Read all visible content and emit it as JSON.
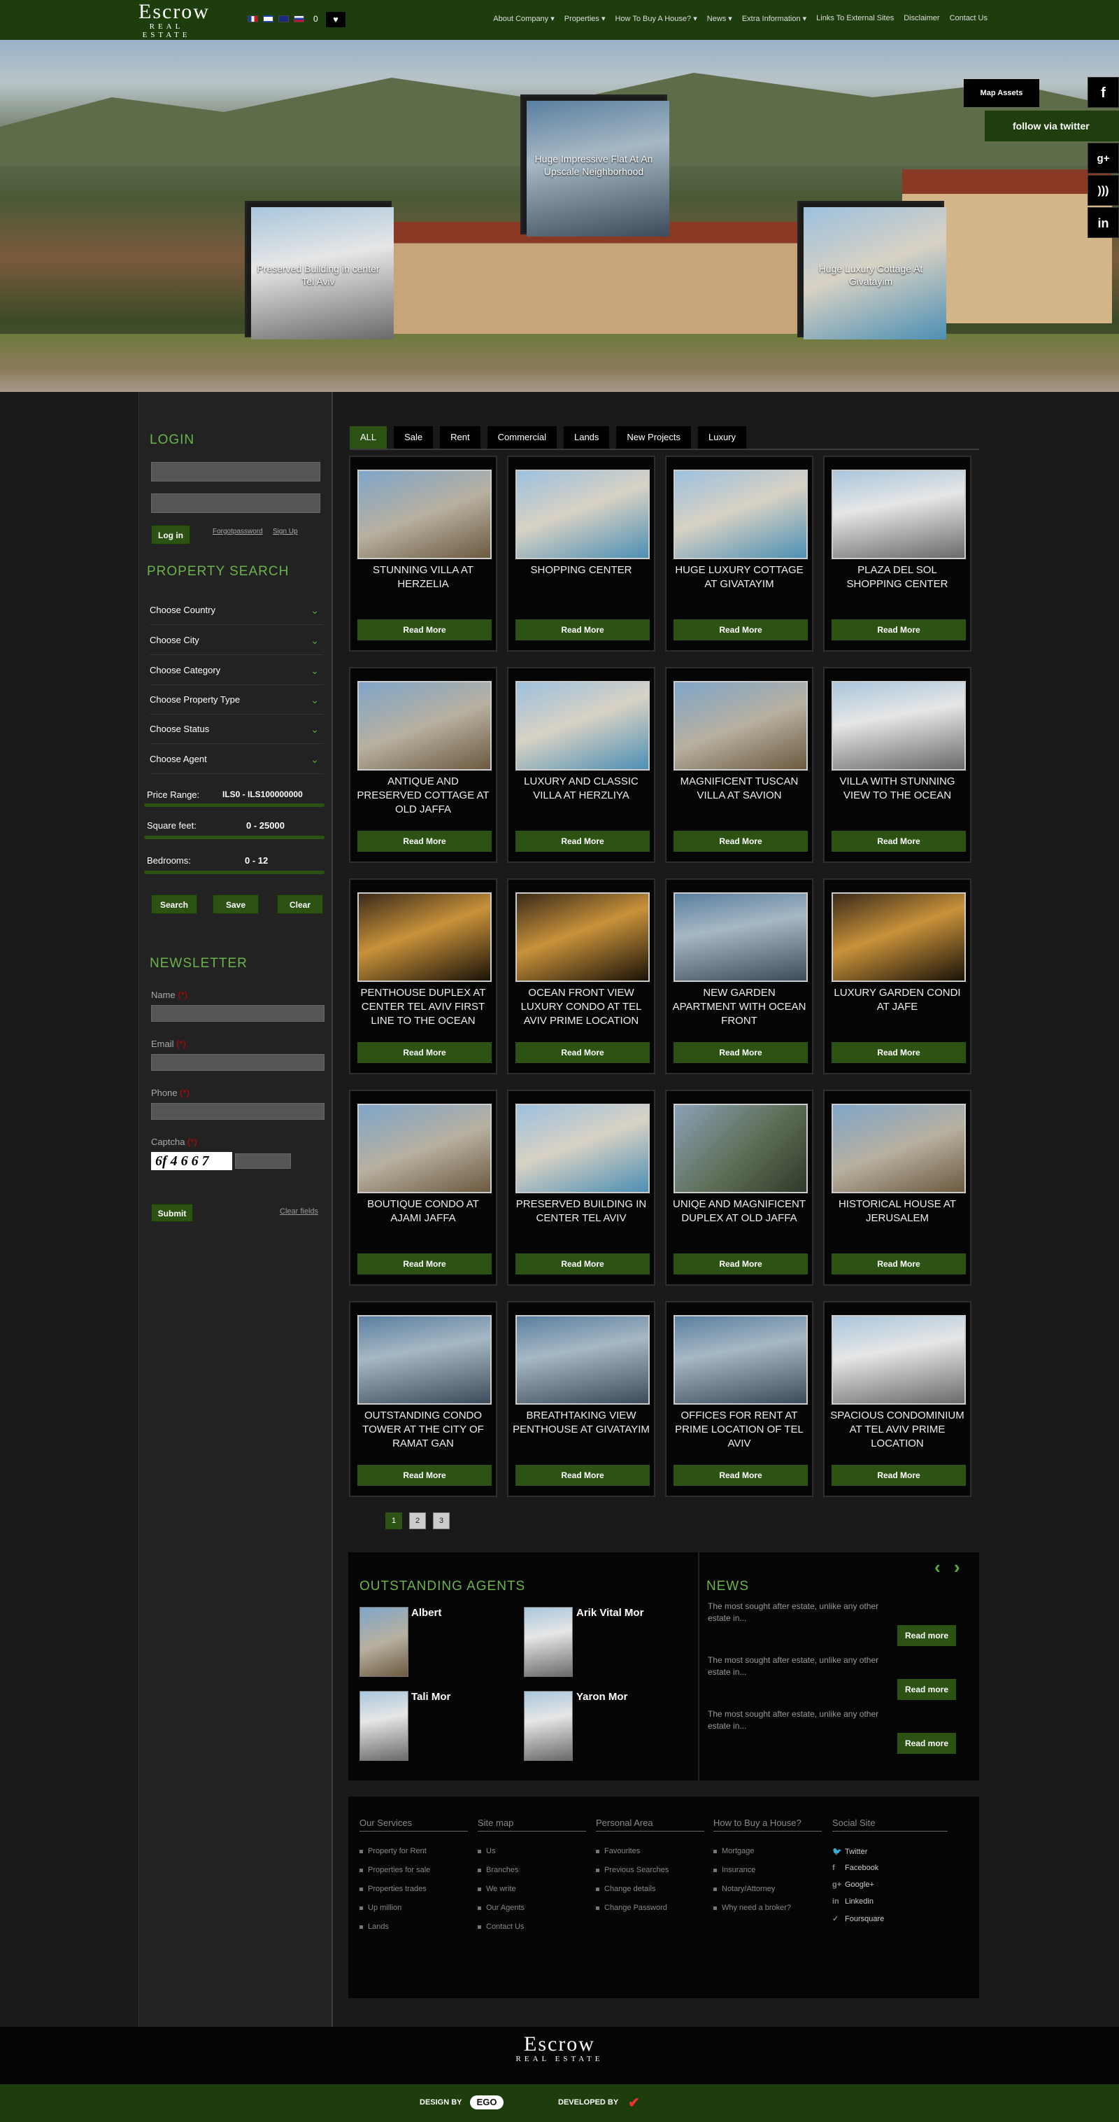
{
  "brand": {
    "name": "Escrow",
    "sub": "REAL ESTATE"
  },
  "header": {
    "cart_count": "0",
    "nav": [
      "About Company",
      "Properties",
      "How To Buy A House?",
      "News",
      "Extra Information",
      "Links To External Sites",
      "Disclaimer",
      "Contact Us"
    ]
  },
  "hero": {
    "map_button": "Map Assets",
    "follow": "follow via twitter",
    "slides": [
      "Huge Impressive Flat At An Upscale Neighborhood",
      "Preserved Building in center Tel Aviv",
      "Huge Luxury Cottage At Givatayim"
    ]
  },
  "sidebar": {
    "login_title": "LOGIN",
    "login_button": "Log in",
    "forgot": "Forgotpassword",
    "signup": "Sign Up",
    "search_title": "PROPERTY SEARCH",
    "dropdowns": [
      "Choose Country",
      "Choose City",
      "Choose Category",
      "Choose Property Type",
      "Choose Status",
      "Choose Agent"
    ],
    "price_label": "Price Range:",
    "price_value": "ILS0 - ILS100000000",
    "sqft_label": "Square feet:",
    "sqft_value": "0 - 25000",
    "bed_label": "Bedrooms:",
    "bed_value": "0 - 12",
    "search_btn": "Search",
    "save_btn": "Save",
    "clear_btn": "Clear",
    "newsletter_title": "NEWSLETTER",
    "name_label": "Name",
    "email_label": "Email",
    "phone_label": "Phone",
    "captcha_label": "Captcha",
    "captcha_text": "6f 4 6 6 7",
    "submit_btn": "Submit",
    "clear_fields": "Clear fields",
    "required_mark": "(*)"
  },
  "tabs": [
    "ALL",
    "Sale",
    "Rent",
    "Commercial",
    "Lands",
    "New Projects",
    "Luxury"
  ],
  "read_more": "Read More",
  "properties": [
    "Stunning Villa At Herzelia",
    "Shopping Center",
    "Huge Luxury Cottage At Givatayim",
    "Plaza Del Sol Shopping Center",
    "Antique and Preserved Cottage At Old Jaffa",
    "Luxury and Classic Villa At Herzliya",
    "Magnificent Tuscan Villa At Savion",
    "Villa With Stunning View To The Ocean",
    "Penthouse Duplex At Center Tel Aviv First Line To The Ocean",
    "Ocean Front View Luxury Condo At Tel Aviv Prime Location",
    "New Garden Apartment With Ocean Front",
    "Luxury Garden Condi At Jafe",
    "Boutique Condo At Ajami Jaffa",
    "Preserved Building In Center Tel Aviv",
    "Uniqe and Magnificent Duplex At Old Jaffa",
    "Historical House At Jerusalem",
    "Outstanding Condo Tower At The City of Ramat Gan",
    "Breathtaking View Penthouse At Givatayim",
    "Offices For Rent At Prime Location of Tel Aviv",
    "Spacious Condominium At Tel Aviv Prime Location"
  ],
  "pagination": [
    "1",
    "2",
    "3"
  ],
  "agents": {
    "title": "OUTSTANDING AGENTS",
    "list": [
      "Albert",
      "Arik Vital Mor",
      "Tali Mor",
      "Yaron Mor"
    ]
  },
  "news": {
    "title": "NEWS",
    "items": [
      "The most sought after estate, unlike any other estate in...",
      "The most sought after estate, unlike any other estate in...",
      "The most sought after estate, unlike any other estate in..."
    ],
    "button": "Read more"
  },
  "footer": {
    "columns": [
      {
        "title": "Our Services",
        "links": [
          "Property for Rent",
          "Properties for sale",
          "Properties trades",
          "Up million",
          "Lands"
        ]
      },
      {
        "title": "Site map",
        "links": [
          "Us",
          "Branches",
          "We write",
          "Our Agents",
          "Contact Us"
        ]
      },
      {
        "title": "Personal Area",
        "links": [
          "Favourites",
          "Previous Searches",
          "Change details",
          "Change Password"
        ]
      },
      {
        "title": "How to Buy a House?",
        "links": [
          "Mortgage",
          "Insurance",
          "Notary/Attorney",
          "Why need a broker?"
        ]
      }
    ],
    "social_title": "Social Site",
    "social": [
      "Twitter",
      "Facebook",
      "Google+",
      "Linkedin",
      "Foursquare"
    ],
    "design_by": "DESIGN BY",
    "design_logo": "EGO",
    "developed_by": "DEVELOPED BY"
  },
  "colors": {
    "accent": "#2c5214",
    "heading": "#6bb34a",
    "header_bg": "#1d3d0c"
  }
}
